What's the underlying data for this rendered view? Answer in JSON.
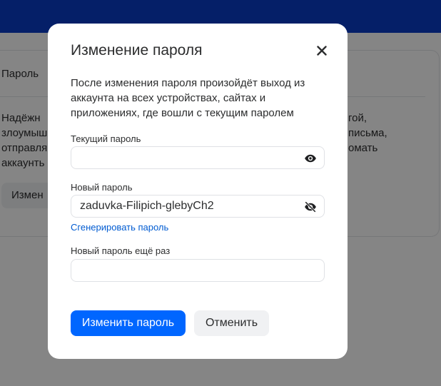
{
  "background": {
    "heading": "Пароль",
    "text_left": "Надёжн\nзлоумыш\nотправля\nаккаунть",
    "text_right": "гой,\nписьма,\nомать",
    "button_label": "Измен"
  },
  "modal": {
    "title": "Изменение пароля",
    "description": "После изменения пароля произойдёт выход из аккаунта на всех устройствах, сайтах и приложениях, где вошли с текущим паролем",
    "current_password": {
      "label": "Текущий пароль",
      "value": "",
      "icon": "eye-icon"
    },
    "new_password": {
      "label": "Новый пароль",
      "value": "zaduvka-Filipich-glebyCh2",
      "icon": "eye-off-icon"
    },
    "generate_link": "Сгенерировать пароль",
    "repeat_password": {
      "label": "Новый пароль ещё раз",
      "value": ""
    },
    "submit_label": "Изменить пароль",
    "cancel_label": "Отменить"
  },
  "colors": {
    "header": "#0a3cc8",
    "primary": "#0066ff",
    "link": "#005bd1",
    "text": "#2c2d2e"
  }
}
